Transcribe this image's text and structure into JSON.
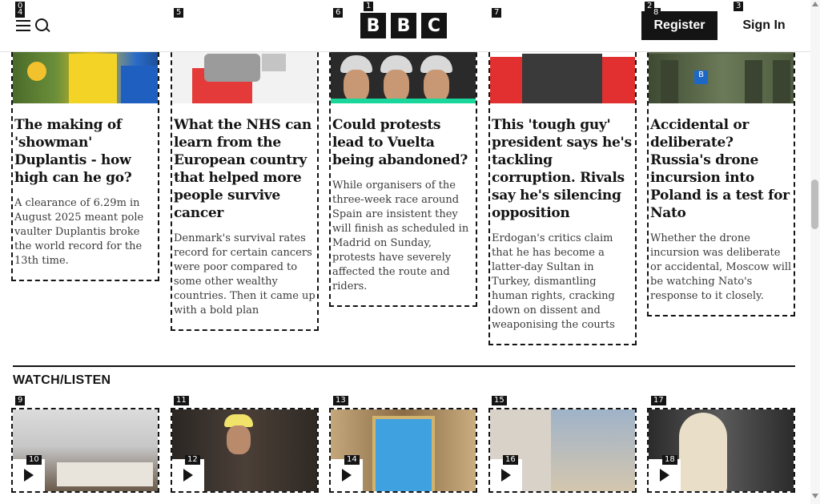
{
  "header": {
    "logo_letters": [
      "B",
      "B",
      "C"
    ],
    "register_label": "Register",
    "signin_label": "Sign In"
  },
  "stories": [
    {
      "headline": "The making of 'showman' Duplantis - how high can he go?",
      "summary": "A clearance of 6.29m in August 2025 meant pole vaulter Duplantis broke the world record for the 13th time."
    },
    {
      "headline": "What the NHS can learn from the European country that helped more people survive cancer",
      "summary": "Denmark's survival rates record for certain cancers were poor compared to some other wealthy countries. Then it came up with a bold plan"
    },
    {
      "headline": "Could protests lead to Vuelta being abandoned?",
      "summary": "While organisers of the three-week race around Spain are insistent they will finish as scheduled in Madrid on Sunday, protests have severely affected the route and riders."
    },
    {
      "headline": "This 'tough guy' president says he's tackling corruption. Rivals say he's silencing opposition",
      "summary": "Erdogan's critics claim that he has become a latter-day Sultan in Turkey, dismantling human rights, cracking down on dissent and weaponising the courts"
    },
    {
      "headline": "Accidental or deliberate? Russia's drone incursion into Poland is a test for Nato",
      "summary": "Whether the drone incursion was deliberate or accidental, Moscow will be watching Nato's response to it closely."
    }
  ],
  "image_text": {
    "bus_stop_sign": "B"
  },
  "watch_listen": {
    "title": "WATCH/LISTEN"
  },
  "markers": [
    "0",
    "4",
    "5",
    "1",
    "6",
    "7",
    "2",
    "8",
    "3",
    "9",
    "10",
    "11",
    "12",
    "13",
    "14",
    "15",
    "16",
    "17",
    "18"
  ],
  "colors": {
    "accent_green": "#19d79a",
    "brand_black": "#141414"
  }
}
